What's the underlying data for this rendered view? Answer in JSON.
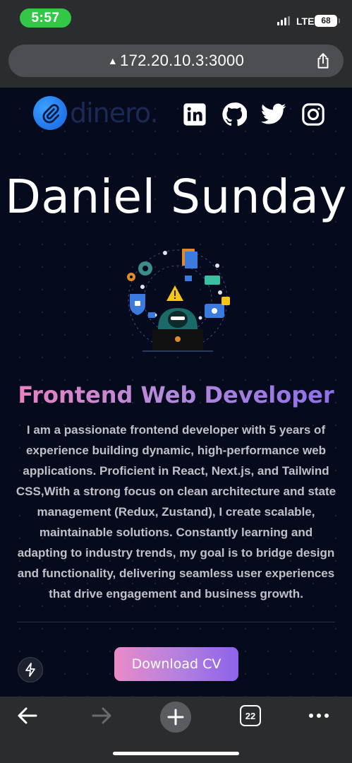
{
  "status_bar": {
    "time": "5:57",
    "network": "LTE",
    "battery": "68"
  },
  "browser": {
    "url": "172.20.10.3:3000",
    "tab_count": "22"
  },
  "nav": {
    "logo_text": "dinero.",
    "socials": [
      "linkedin-icon",
      "github-icon",
      "twitter-icon",
      "instagram-icon"
    ]
  },
  "hero": {
    "name": "Daniel Sunday",
    "role": "Frontend Web Developer",
    "bio": "I am a passionate frontend developer with 5 years of experience building dynamic, high-performance web applications. Proficient in React, Next.js, and Tailwind CSS,With a strong focus on clean architecture and state management (Redux, Zustand), I create scalable, maintainable solutions. Constantly learning and adapting to industry trends, my goal is to bridge design and functionality, delivering seamless user experiences that drive engagement and business growth.",
    "cta_label": "Download CV"
  },
  "colors": {
    "page_bg": "#050a1c",
    "accent_pink": "#e98bc8",
    "accent_purple": "#8e62ea",
    "status_green": "#33c748"
  }
}
